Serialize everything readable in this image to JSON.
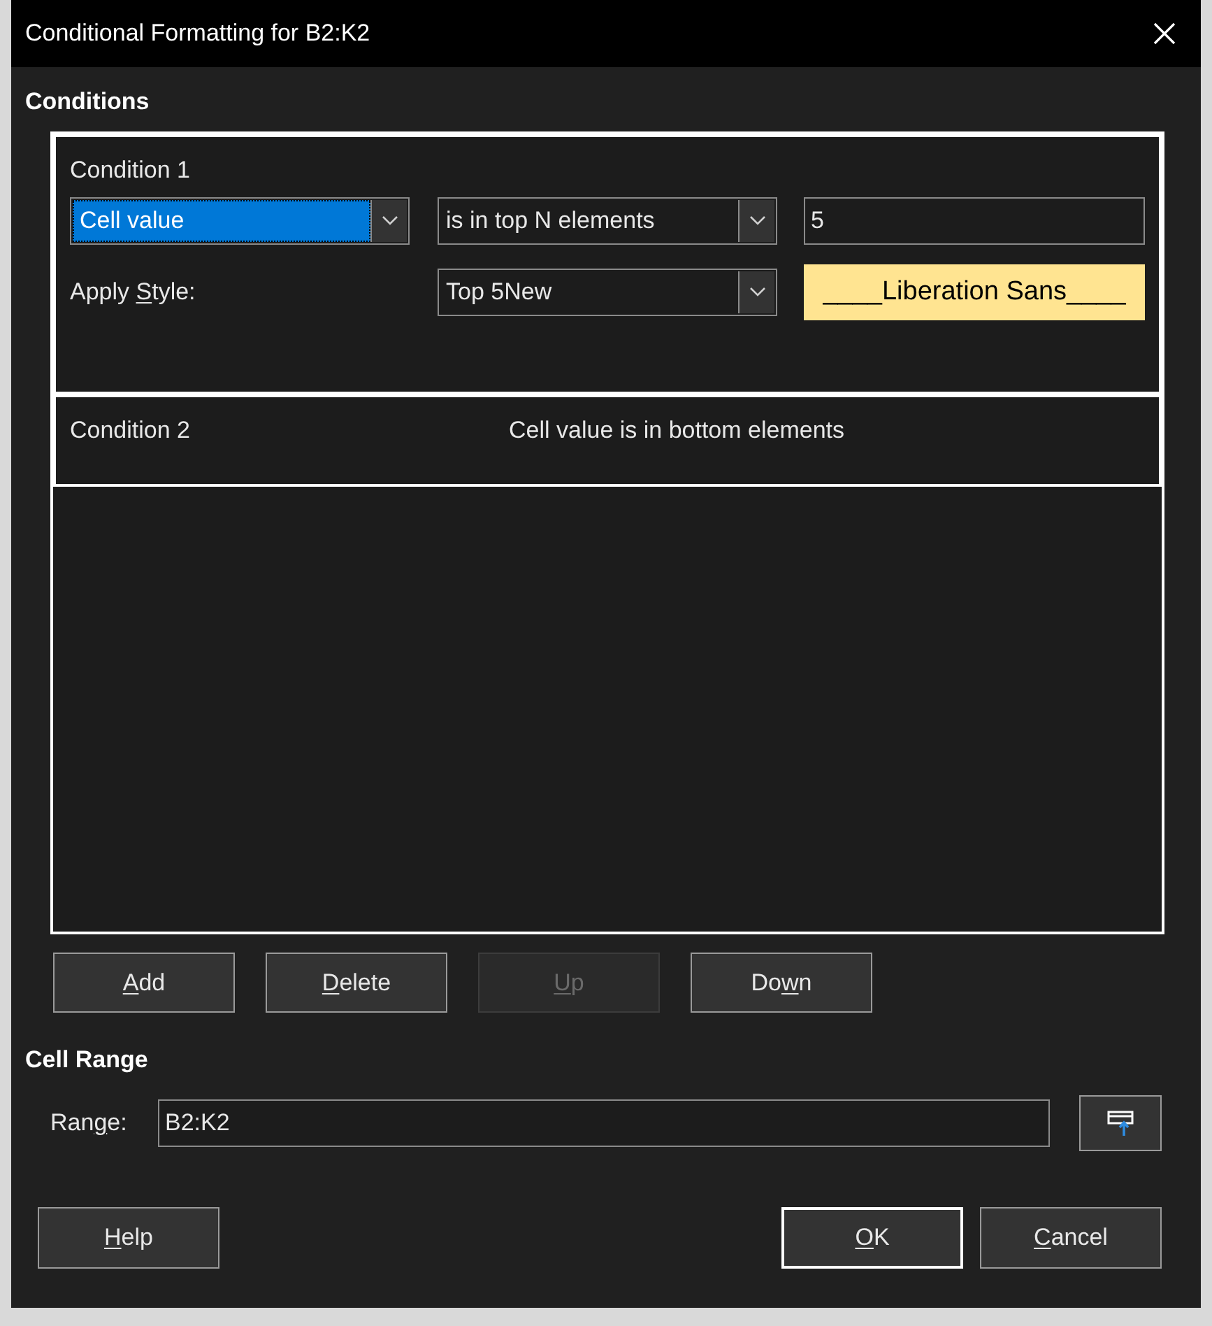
{
  "window": {
    "title": "Conditional Formatting for B2:K2"
  },
  "conditions_section": {
    "heading": "Conditions"
  },
  "conditions": [
    {
      "kind": "expanded",
      "title": "Condition 1",
      "type_dropdown": {
        "value": "Cell value",
        "focused": true
      },
      "operator_dropdown": {
        "value": "is in top N elements"
      },
      "value_field": {
        "value": "5"
      },
      "style_label": {
        "text_before": "Apply ",
        "access_key": "S",
        "text_after": "tyle:"
      },
      "style_dropdown": {
        "value": "Top 5New"
      },
      "style_preview": {
        "text": "____Liberation Sans____"
      }
    },
    {
      "kind": "collapsed",
      "title": "Condition 2",
      "summary": "Cell value is in bottom elements"
    }
  ],
  "list_buttons": [
    {
      "access_key": "A",
      "text_after": "dd",
      "disabled": false
    },
    {
      "access_key": "D",
      "text_after": "elete",
      "disabled": false
    },
    {
      "access_key": "U",
      "text_after": "p",
      "disabled": true
    },
    {
      "text_before": "Do",
      "access_key": "w",
      "text_after": "n",
      "disabled": false
    }
  ],
  "cell_range": {
    "heading": "Cell Range",
    "label": {
      "text_before": "Ran",
      "access_key": "g",
      "text_after": "e:"
    },
    "value": "B2:K2"
  },
  "footer_buttons": [
    {
      "access_key": "H",
      "text_after": "elp",
      "default": false
    },
    {
      "access_key": "O",
      "text_after": "K",
      "default": true
    },
    {
      "access_key": "C",
      "text_after": "ancel",
      "default": false
    }
  ]
}
